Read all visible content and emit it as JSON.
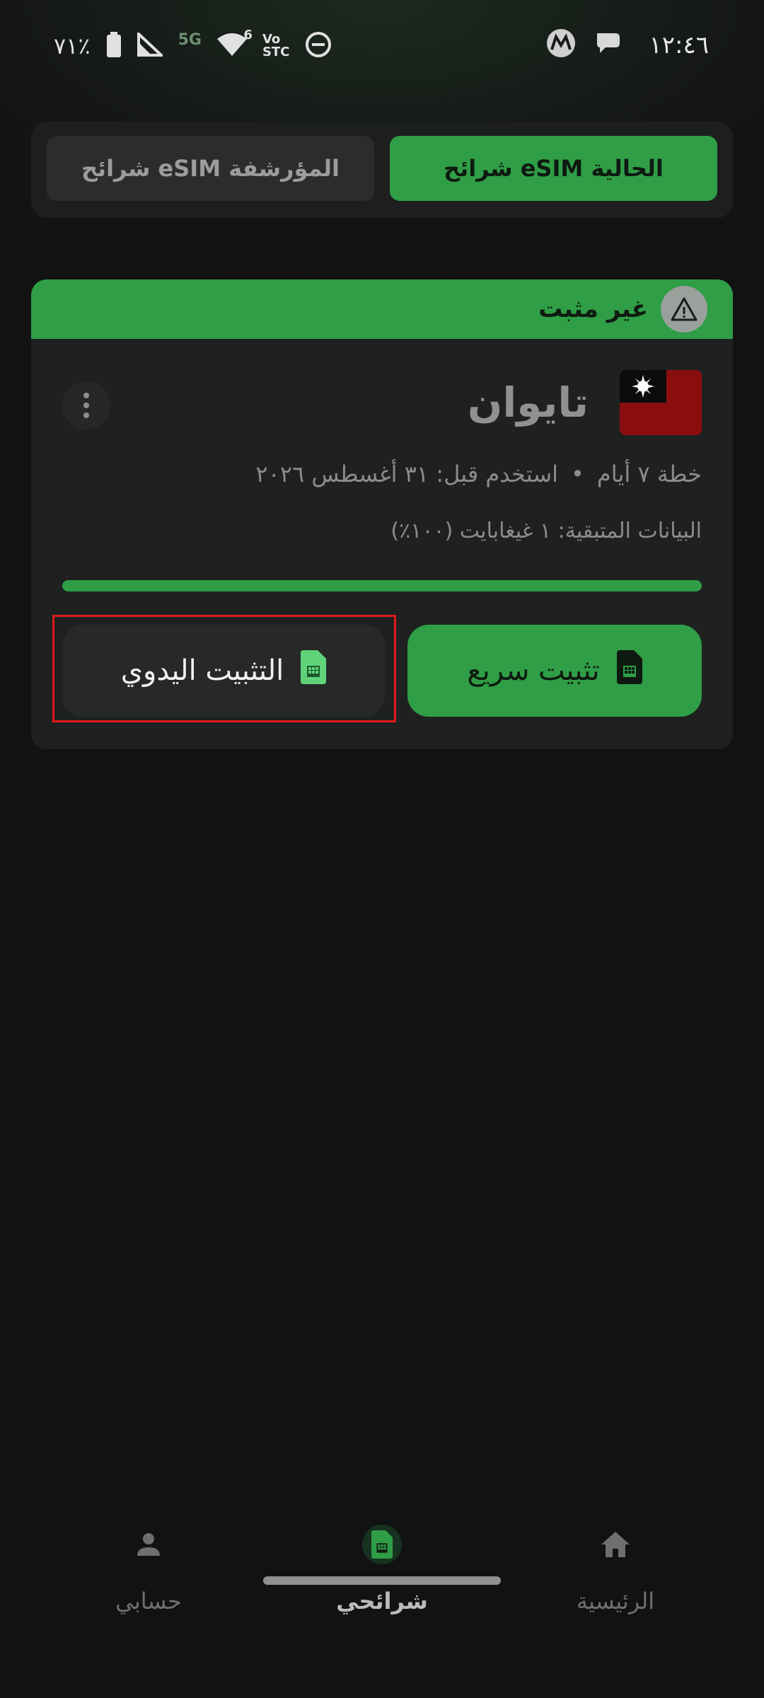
{
  "status_bar": {
    "time": "١٢:٤٦",
    "battery": "٧١٪",
    "network": "5G",
    "volte_top": "Vo",
    "volte_bottom": "STC",
    "wifi_level": "6"
  },
  "tabs": {
    "current": "شرائح eSIM الحالية",
    "archived": "شرائح eSIM المؤرشفة"
  },
  "card": {
    "status": "غير مثبت",
    "country": "تايوان",
    "plan": "خطة ٧ أيام",
    "separator": "•",
    "use_before": "استخدم قبل: ٣١ أغسطس ٢٠٢٦",
    "data_remaining": "البيانات المتبقية: ١ غيغابايت (١٠٠٪)",
    "progress_percent": 100,
    "quick_install_label": "تثبيت سريع",
    "manual_install_label": "التثبيت اليدوي"
  },
  "nav": {
    "home": "الرئيسية",
    "my_sims": "شرائحي",
    "account": "حسابي"
  },
  "colors": {
    "accent": "#2f9e46",
    "highlight": "#e01b1b"
  }
}
